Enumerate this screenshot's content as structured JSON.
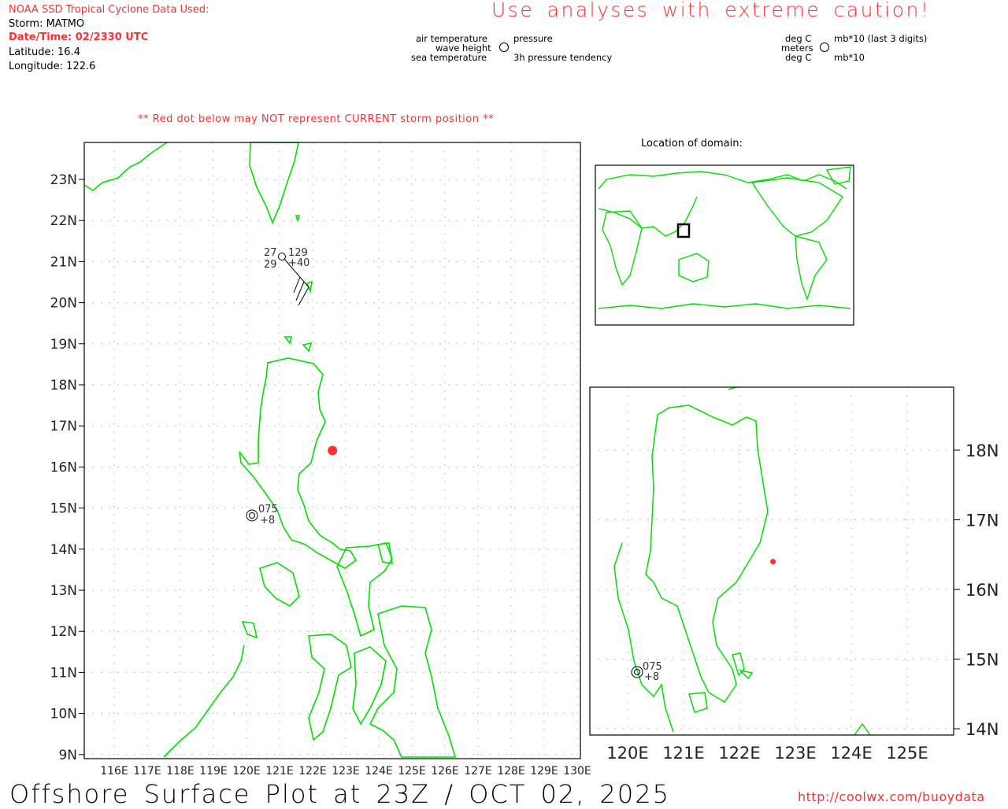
{
  "header": {
    "source": "NOAA SSD Tropical Cyclone Data Used:",
    "storm": "Storm: MATMO",
    "datetime": "Date/Time: 02/2330 UTC",
    "latitude": "Latitude: 16.4",
    "longitude": "Longitude: 122.6",
    "caution": "Use analyses with extreme caution!",
    "red_dot_note": "** Red dot below may NOT represent CURRENT storm position **"
  },
  "legend": {
    "left": {
      "air_temp": "air temperature",
      "wave_height": "wave height",
      "sea_temp": "sea temperature",
      "pressure": "pressure",
      "tendency": "3h pressure tendency"
    },
    "right": {
      "deg_c_top": "deg C",
      "meters": "meters",
      "deg_c_bottom": "deg C",
      "mb_last3": "mb*10 (last 3 digits)",
      "mb10": "mb*10"
    }
  },
  "main_map": {
    "lat_labels": [
      "23N",
      "22N",
      "21N",
      "20N",
      "19N",
      "18N",
      "17N",
      "16N",
      "15N",
      "14N",
      "13N",
      "12N",
      "11N",
      "10N",
      "9N"
    ],
    "lon_labels": [
      "116E",
      "117E",
      "118E",
      "119E",
      "120E",
      "121E",
      "122E",
      "123E",
      "124E",
      "125E",
      "126E",
      "127E",
      "128E",
      "129E",
      "130E"
    ],
    "storm_position": {
      "lat": 16.4,
      "lon": 122.6
    },
    "station_1": {
      "air_temp": "27",
      "sea_temp": "29",
      "pressure": "129",
      "tendency": "+40"
    },
    "station_2": {
      "pressure": "075",
      "tendency": "+8"
    }
  },
  "domain_map": {
    "title": "Location of domain:"
  },
  "zoom_map": {
    "lat_labels": [
      "18N",
      "17N",
      "16N",
      "15N",
      "14N"
    ],
    "lon_labels": [
      "120E",
      "121E",
      "122E",
      "123E",
      "124E",
      "125E"
    ],
    "station_2": {
      "pressure": "075",
      "tendency": "+8"
    }
  },
  "footer": {
    "title": "Offshore Surface Plot at 23Z / OCT 02, 2025",
    "url": "http://coolwx.com/buoydata"
  },
  "colors": {
    "land": "#00e000",
    "storm": "#ff3030",
    "grid": "#aaaaaa"
  }
}
